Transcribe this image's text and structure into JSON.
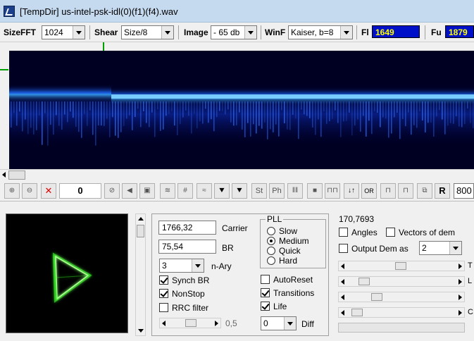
{
  "window": {
    "title": "[TempDir] us-intel-psk-idl(0)(f1)(f4).wav"
  },
  "toolbar1": {
    "sizefft_label": "SizeFFT",
    "sizefft_value": "1024",
    "shear_label": "Shear",
    "shear_value": "Size/8",
    "image_label": "Image",
    "image_value": "- 65 db",
    "winf_label": "WinF",
    "winf_value": "Kaiser, b=8",
    "fl_label": "Fl",
    "fl_value": "1649",
    "fu_label": "Fu",
    "fu_value": "1879"
  },
  "toolbar2": {
    "count_value": "0",
    "st_label": "St",
    "ph_label": "Ph",
    "r_label": "R",
    "rate_value": "800"
  },
  "demod": {
    "carrier_value": "1766,32",
    "carrier_label": "Carrier",
    "br_value": "75,54",
    "br_label": "BR",
    "nary_value": "3",
    "nary_label": "n-Ary",
    "synch_br_label": "Synch BR",
    "nonstop_label": "NonStop",
    "rrc_label": "RRC filter",
    "slider_value": "0,5",
    "pll_title": "PLL",
    "pll_slow": "Slow",
    "pll_medium": "Medium",
    "pll_quick": "Quick",
    "pll_hard": "Hard",
    "autoreset_label": "AutoReset",
    "transitions_label": "Transitions",
    "life_label": "Life",
    "diff_value": "0",
    "diff_label": "Diff"
  },
  "right": {
    "readout": "170,7693",
    "angles_label": "Angles",
    "vectors_label": "Vectors of dem",
    "output_dem_label": "Output Dem as",
    "output_dem_value": "2",
    "side_letters": [
      "T",
      "L",
      "",
      "C"
    ]
  },
  "colors": {
    "spectro_bg": "#000022",
    "spectro_line": "#1e8cff",
    "constellation": "#33ff22",
    "field_blue": "#0010c8",
    "field_text": "#ffff00"
  }
}
